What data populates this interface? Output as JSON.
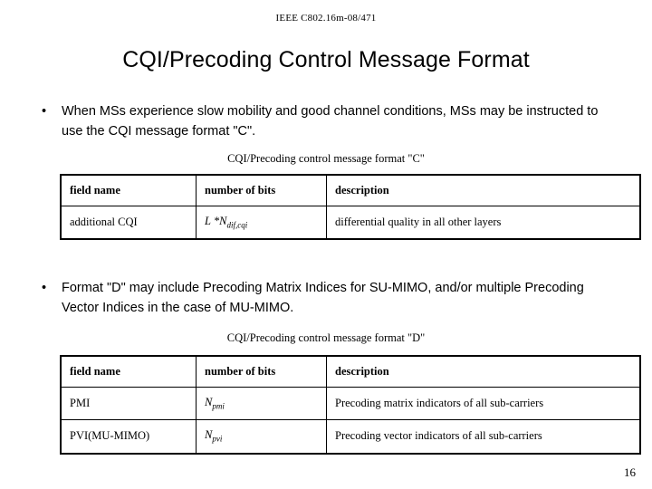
{
  "header": {
    "reference": "IEEE C802.16m-08/471"
  },
  "title": "CQI/Precoding Control Message Format",
  "bullets": [
    {
      "marker": "•",
      "text": "When MSs experience slow mobility and good channel conditions, MSs may be instructed to use the CQI message format \"C\"."
    },
    {
      "marker": "•",
      "text": "Format \"D\" may include Precoding Matrix Indices for SU-MIMO, and/or multiple Precoding Vector Indices in the case of MU-MIMO."
    }
  ],
  "table_c": {
    "caption": "CQI/Precoding control message format \"C\"",
    "headers": [
      "field name",
      "number of bits",
      "description"
    ],
    "rows": [
      {
        "field_name": "additional CQI",
        "number_of_bits_main": "L *N",
        "number_of_bits_sub": "dif,cqi",
        "description": "differential quality in all other layers"
      }
    ]
  },
  "table_d": {
    "caption": "CQI/Precoding control message format \"D\"",
    "headers": [
      "field name",
      "number of bits",
      "description"
    ],
    "rows": [
      {
        "field_name": "PMI",
        "number_of_bits_main": "N",
        "number_of_bits_sub": "pmi",
        "description": "Precoding matrix indicators of all sub-carriers"
      },
      {
        "field_name": "PVI(MU-MIMO)",
        "number_of_bits_main": "N",
        "number_of_bits_sub": "pvi",
        "description": "Precoding vector indicators of all sub-carriers"
      }
    ]
  },
  "page_number": "16"
}
